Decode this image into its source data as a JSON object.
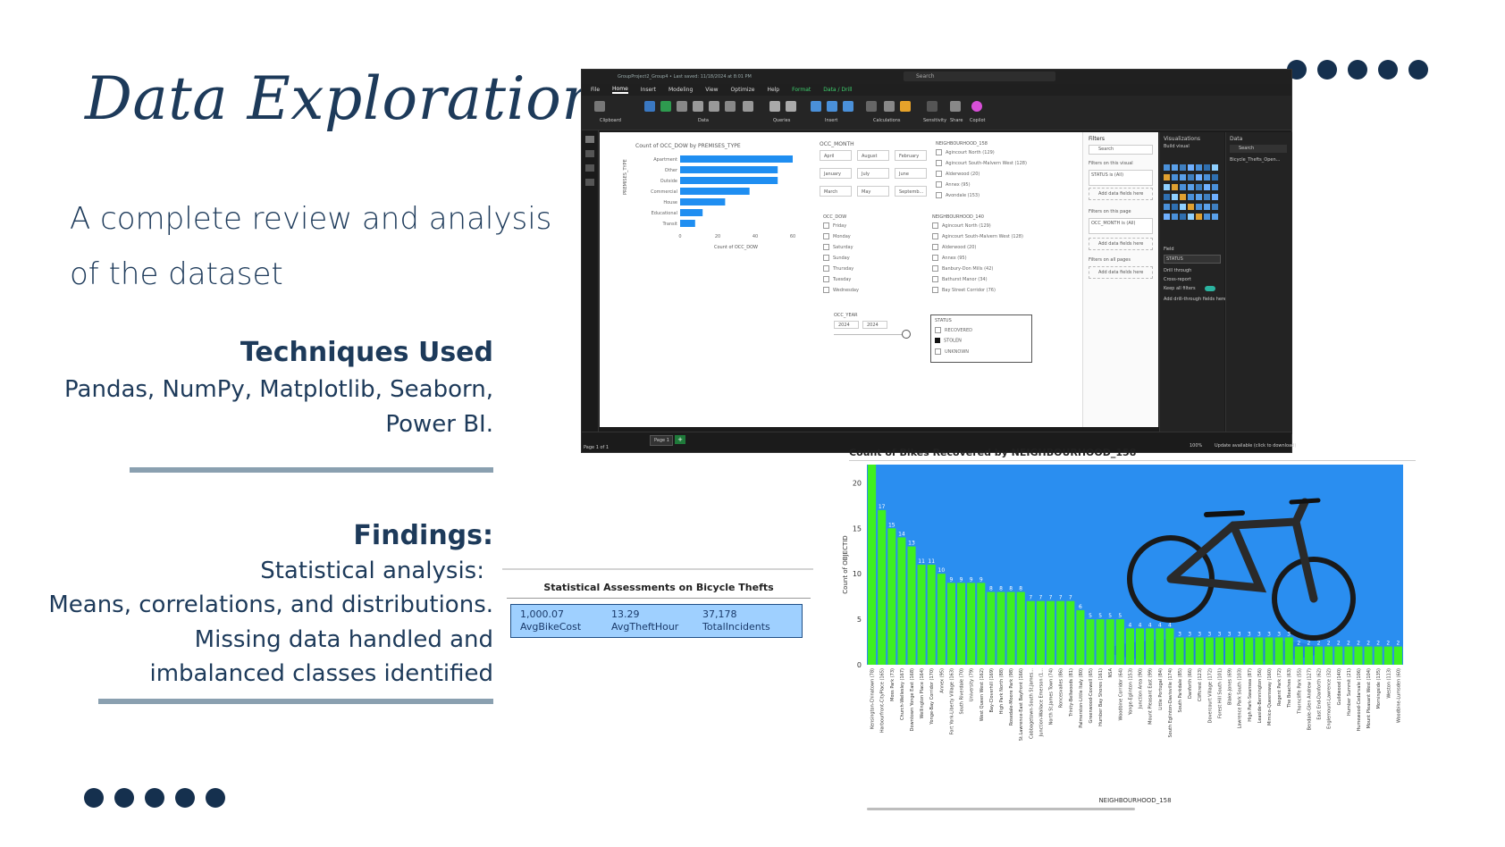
{
  "slide": {
    "title": "Data Exploration",
    "subtitle": "A complete review and analysis of the dataset",
    "techniques_heading": "Techniques Used",
    "techniques_line1": "Pandas, NumPy, Matplotlib, Seaborn,",
    "techniques_line2": "Power BI.",
    "findings_heading": "Findings:",
    "findings_lines": [
      "Statistical analysis:",
      "Means, correlations, and distributions.",
      "Missing data handled and",
      "imbalanced classes identified"
    ],
    "colors": {
      "navy": "#1d3a5a",
      "dot": "#15304e",
      "rule": "#8aa0b0"
    }
  },
  "powerbi": {
    "window_title": "GroupProject2_Group4 • Last saved: 11/18/2024 at 8:01 PM",
    "search": "Search",
    "menu": [
      "File",
      "Home",
      "Insert",
      "Modeling",
      "View",
      "Optimize",
      "Help",
      "Format",
      "Data / Drill"
    ],
    "active_menu": "Home",
    "ribbon_groups": [
      "Clipboard",
      "Data",
      "Queries",
      "Insert",
      "Calculations",
      "Sensitivity",
      "Share",
      "Copilot"
    ],
    "bar_visual": {
      "title": "Count of OCC_DOW by PREMISES_TYPE",
      "ylabel": "PREMISES_TYPE",
      "xlabel": "Count of OCC_DOW",
      "categories": [
        "Apartment",
        "Other",
        "Outside",
        "Commercial",
        "House",
        "Educational",
        "Transit"
      ],
      "values": [
        63,
        52,
        52,
        37,
        24,
        12,
        8
      ],
      "x_ticks": [
        "0",
        "20",
        "40",
        "60"
      ]
    },
    "month_slicer": {
      "title": "OCC_MONTH",
      "options": [
        "April",
        "August",
        "February",
        "January",
        "July",
        "June",
        "March",
        "May",
        "Septemb..."
      ]
    },
    "dow_slicer": {
      "title": "OCC_DOW",
      "options": [
        "Friday",
        "Monday",
        "Saturday",
        "Sunday",
        "Thursday",
        "Tuesday",
        "Wednesday"
      ]
    },
    "nbh158_slicer": {
      "title": "NEIGHBOURHOOD_158",
      "options": [
        "Agincourt North (129)",
        "Agincourt South-Malvern West (128)",
        "Alderwood (20)",
        "Annex (95)",
        "Avondale (153)"
      ]
    },
    "nbh140_slicer": {
      "title": "NEIGHBOURHOOD_140",
      "options": [
        "Agincourt North (129)",
        "Agincourt South-Malvern West (128)",
        "Alderwood (20)",
        "Annex (95)",
        "Banbury-Don Mills (42)",
        "Bathurst Manor (34)",
        "Bay Street Corridor (76)"
      ]
    },
    "year_slicer": {
      "title": "OCC_YEAR",
      "from": "2024",
      "to": "2024"
    },
    "status_slicer": {
      "title": "STATUS",
      "options": [
        "RECOVERED",
        "STOLEN",
        "UNKNOWN"
      ],
      "checked": "STOLEN"
    },
    "filters_pane": {
      "title": "Filters",
      "search": "Search",
      "on_visual": "Filters on this visual",
      "status_filter": "STATUS is (All)",
      "add_fields": "Add data fields here",
      "on_page": "Filters on this page",
      "month_filter": "OCC_MONTH is (All)",
      "on_all": "Filters on all pages"
    },
    "viz_pane": {
      "title": "Visualizations",
      "build": "Build visual",
      "field": "Field",
      "field_value": "STATUS",
      "drill": "Drill through",
      "cross": "Cross-report",
      "keep": "Keep all filters",
      "add_drill": "Add drill-through fields here"
    },
    "data_pane": {
      "title": "Data",
      "search": "Search",
      "table": "Bicycle_Thefts_Open..."
    },
    "page_tab": "Page 1",
    "status_bar": "Page 1 of 1",
    "zoom": "100%",
    "update": "Update available (click to download)"
  },
  "stats": {
    "title": "Statistical Assessments on Bicycle Thefts",
    "cards": [
      {
        "value": "1,000.07",
        "label": "AvgBikeCost"
      },
      {
        "value": "13.29",
        "label": "AvgTheftHour"
      },
      {
        "value": "37,178",
        "label": "TotalIncidents"
      }
    ]
  },
  "chart_data": {
    "type": "bar",
    "title": "Count of Bikes Recovered by NEIGHBOURHOOD_158",
    "xlabel": "NEIGHBOURHOOD_158",
    "ylabel": "Count of OBJECTID",
    "ylim": [
      0,
      22
    ],
    "yticks": [
      0,
      5,
      10,
      15,
      20
    ],
    "grid": false,
    "bar_color": "#3ef021",
    "background": "#2a8ef0",
    "categories": [
      "Kensington-Chinatown (78)",
      "Harbourfront-CityPlace (165)",
      "Moss Park (73)",
      "Church-Wellesley (167)",
      "Downtown Yonge East (168)",
      "Wellington Place (164)",
      "Yonge-Bay Corridor (170)",
      "Annex (95)",
      "Fort York-Liberty Village (163)",
      "South Riverdale (70)",
      "University (79)",
      "West Queen West (162)",
      "Bay-Cloverhill (169)",
      "High Park North (88)",
      "Rosedale-Moore Park (98)",
      "St.Lawrence-East Bayfront (166)",
      "Cabbagetown-South St.James...",
      "Junction-Wallace Emerson (1...",
      "North St.James Town (74)",
      "Roncesvalles (86)",
      "Trinity-Bellwoods (81)",
      "Palmerston-Little Italy (80)",
      "Greenwood-Coxwell (65)",
      "Humber Bay Shores (161)",
      "NSA",
      "Woodbine Corridor (64)",
      "Yonge-Eglinton (153)",
      "Junction Area (90)",
      "Mount Pleasant East (99)",
      "Little Portugal (84)",
      "South Eglinton-Davisville (174)",
      "South Parkdale (85)",
      "Danforth (66)",
      "Cliffcrest (123)",
      "Dovercourt Village (172)",
      "Forest Hill South (101)",
      "Blake-Jones (69)",
      "Lawrence Park South (103)",
      "High Park-Swansea (87)",
      "Leaside-Bennington (56)",
      "Mimico-Queensway (160)",
      "Regent Park (72)",
      "The Beaches (63)",
      "Thorncliffe Park (55)",
      "Bendale-Glen Andrew (127)",
      "East End-Danforth (62)",
      "Englemount-Lawrence (32)",
      "Guildwood (140)",
      "Humber Summit (21)",
      "Humewood-Cedarvale (106)",
      "Mount Pleasant West (104)",
      "Morningside (135)",
      "Weston (113)",
      "Woodbine-Lumsden (60)"
    ],
    "values": [
      22,
      17,
      15,
      14,
      13,
      11,
      11,
      10,
      9,
      9,
      9,
      9,
      8,
      8,
      8,
      8,
      7,
      7,
      7,
      7,
      7,
      6,
      5,
      5,
      5,
      5,
      4,
      4,
      4,
      4,
      4,
      3,
      3,
      3,
      3,
      3,
      3,
      3,
      3,
      3,
      3,
      3,
      3,
      2,
      2,
      2,
      2,
      2,
      2,
      2,
      2,
      2,
      2,
      2
    ]
  }
}
